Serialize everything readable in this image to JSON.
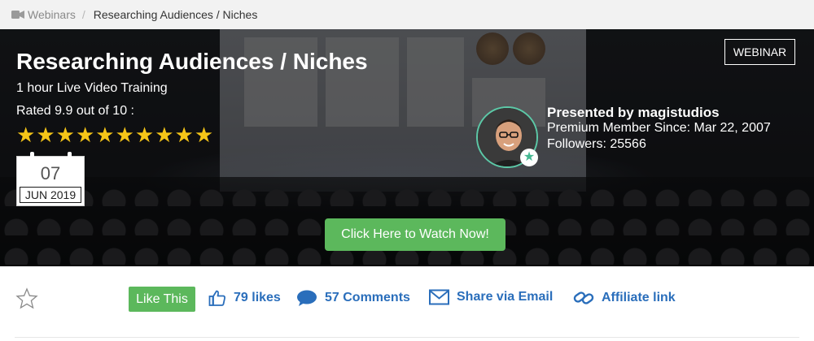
{
  "breadcrumb": {
    "parent": "Webinars",
    "separator": "/",
    "current": "Researching Audiences / Niches"
  },
  "webinar": {
    "title": "Researching Audiences / Niches",
    "subtitle": "1 hour Live Video Training",
    "rating_text": "Rated 9.9 out of 10 :",
    "rating_value": 9.9,
    "rating_max": 10,
    "stars": [
      "★",
      "★",
      "★",
      "★",
      "★",
      "★",
      "★",
      "★",
      "★",
      "★"
    ],
    "date": {
      "day": "07",
      "month_year": "JUN 2019"
    },
    "tag": "WEBINAR",
    "presenter": {
      "name_line": "Presented by magistudios",
      "member_since": "Premium Member Since: Mar 22, 2007",
      "followers": "Followers: 25566"
    },
    "watch_label": "Click Here to Watch Now!"
  },
  "actions": {
    "like_label": "Like This",
    "likes": "79 likes",
    "comments": "57 Comments",
    "share": "Share via Email",
    "affiliate": "Affiliate link"
  },
  "icons": {
    "breadcrumb": "video-camera-icon",
    "favorite": "star-outline-icon",
    "likes": "thumbs-up-icon",
    "comments": "comment-bubble-icon",
    "share": "envelope-icon",
    "affiliate": "link-icon",
    "avatar_badge": "star-badge-icon"
  },
  "colors": {
    "accent_green": "#5cb85c",
    "link_blue": "#2a6ebb",
    "star_gold": "#f5c518",
    "avatar_ring": "#5cc8a7"
  }
}
